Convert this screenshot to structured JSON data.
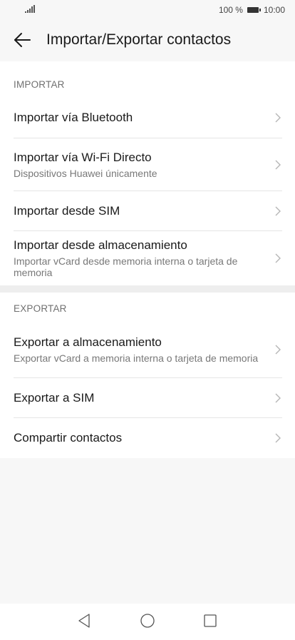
{
  "status_bar": {
    "battery_percent": "100 %",
    "time": "10:00"
  },
  "header": {
    "title": "Importar/Exportar contactos"
  },
  "sections": {
    "import": {
      "header": "IMPORTAR",
      "items": [
        {
          "title": "Importar vía Bluetooth"
        },
        {
          "title": "Importar vía Wi-Fi Directo",
          "subtitle": "Dispositivos Huawei únicamente"
        },
        {
          "title": "Importar desde SIM"
        },
        {
          "title": "Importar desde almacenamiento",
          "subtitle": "Importar vCard desde memoria interna o tarjeta de memoria"
        }
      ]
    },
    "export": {
      "header": "EXPORTAR",
      "items": [
        {
          "title": "Exportar a almacenamiento",
          "subtitle": "Exportar vCard a memoria interna o tarjeta de memoria"
        },
        {
          "title": "Exportar a SIM"
        },
        {
          "title": "Compartir contactos"
        }
      ]
    }
  },
  "icons": {
    "back": "arrow-left-icon",
    "chevron": "chevron-right-icon",
    "nav_back": "triangle-back-icon",
    "nav_home": "circle-home-icon",
    "nav_recents": "square-recents-icon"
  },
  "colors": {
    "background": "#f7f7f7",
    "surface": "#ffffff",
    "text_primary": "#1a1a1a",
    "text_secondary": "#787878",
    "section_header": "#707070"
  }
}
